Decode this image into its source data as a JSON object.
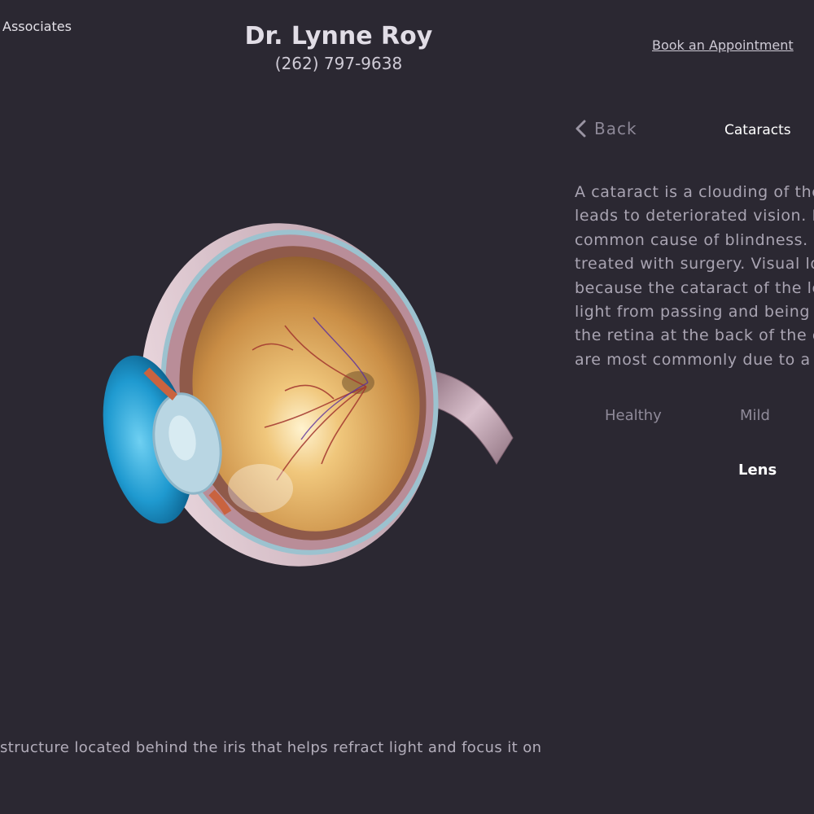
{
  "header": {
    "brand": "Associates",
    "doctor_name": "Dr. Lynne Roy",
    "phone": "(262) 797-9638",
    "book_link": "Book an Appointment"
  },
  "nav": {
    "back_label": "Back",
    "back_icon": "chevron-left-icon",
    "section_title": "Cataracts"
  },
  "description": {
    "lines": [
      "A cataract is a clouding of the",
      "leads to deteriorated vision. I",
      "common cause of blindness.",
      "treated with surgery. Visual lo",
      "because the cataract of the le",
      "light from passing and being",
      "the retina at the back of the e",
      "are most commonly due to a"
    ]
  },
  "severity_tabs": {
    "healthy": "Healthy",
    "mild": "Mild"
  },
  "selected_part": "Lens",
  "caption": "structure located behind the iris that helps refract light and focus it on",
  "colors": {
    "background": "#2b2832",
    "text_primary": "#e1dde6",
    "text_muted": "#a9a4b2",
    "iris_blue": "#1f9ad0",
    "retina_gold": "#d9a85a"
  }
}
